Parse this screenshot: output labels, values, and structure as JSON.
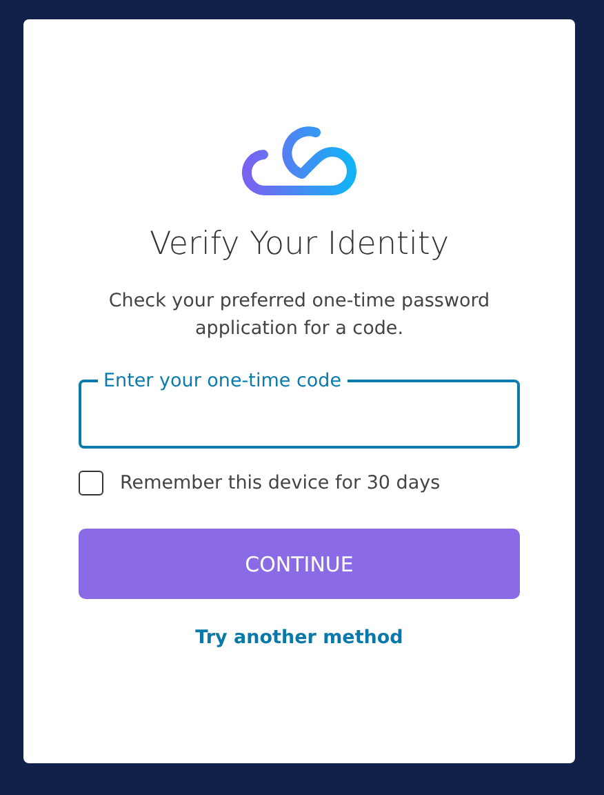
{
  "title": "Verify Your Identity",
  "description": "Check your preferred one-time password application for a code.",
  "code_field": {
    "label": "Enter your one-time code",
    "focused": true
  },
  "remember": {
    "label": "Remember this device for 30 days",
    "checked": false
  },
  "continue_button": "CONTINUE",
  "alternate_link": "Try another method"
}
